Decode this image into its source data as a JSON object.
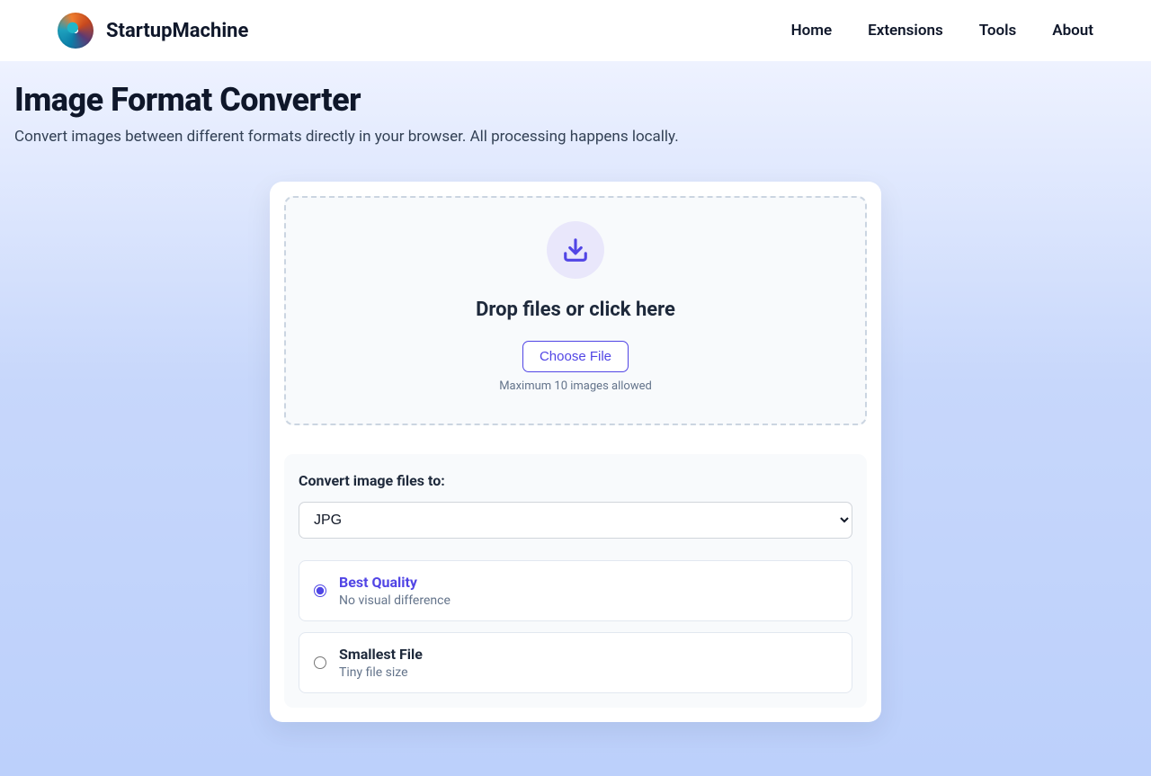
{
  "header": {
    "brand": "StartupMachine",
    "nav": {
      "home": "Home",
      "extensions": "Extensions",
      "tools": "Tools",
      "about": "About"
    }
  },
  "page": {
    "title": "Image Format Converter",
    "subtitle": "Convert images between different formats directly in your browser. All processing happens locally."
  },
  "dropzone": {
    "heading": "Drop files or click here",
    "choose_label": "Choose File",
    "note": "Maximum 10 images allowed"
  },
  "options": {
    "heading": "Convert image files to:",
    "format_selected": "JPG",
    "quality": {
      "best": {
        "title": "Best Quality",
        "desc": "No visual difference"
      },
      "small": {
        "title": "Smallest File",
        "desc": "Tiny file size"
      }
    }
  }
}
